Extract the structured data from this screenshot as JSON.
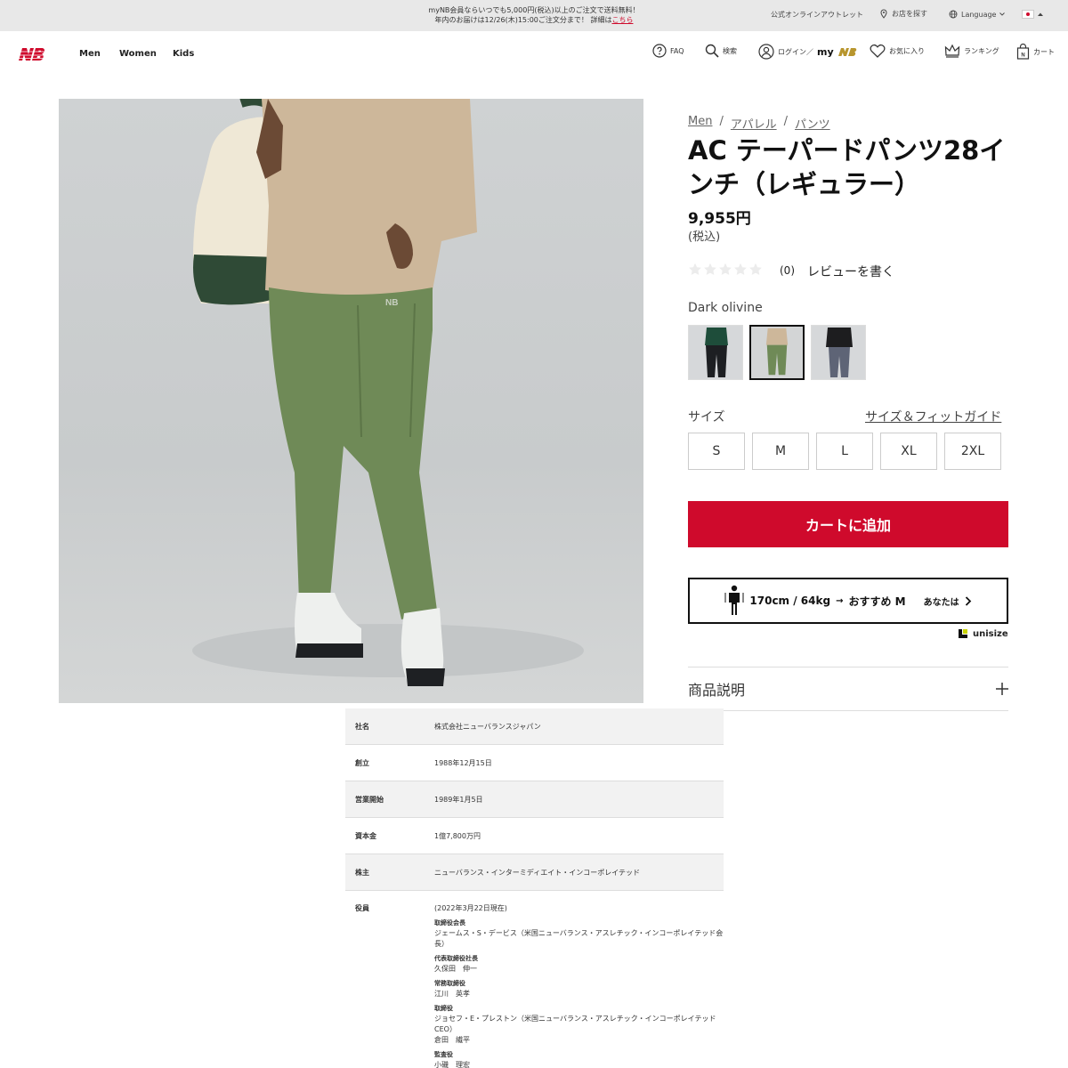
{
  "banner": {
    "line1": "myNB会員ならいつでも5,000円(税込)以上のご注文で送料無料！",
    "line2_prefix": "年内のお届けは12/26(木)15:00ご注文分まで！ 詳細は",
    "line2_link": "こちら"
  },
  "utility": {
    "outlet": "公式オンラインアウトレット",
    "store": "お店を探す",
    "language": "Language"
  },
  "nav": [
    "Men",
    "Women",
    "Kids"
  ],
  "header_icons": {
    "faq": "FAQ",
    "search": "検索",
    "login": "ログイン／",
    "mynb": "my",
    "favorites": "お気に入り",
    "ranking": "ランキング",
    "cart": "カート"
  },
  "breadcrumb": [
    "Men",
    "アパレル",
    "パンツ"
  ],
  "product": {
    "title": "AC テーパードパンツ28インチ（レギュラー）",
    "price": "9,955円",
    "tax": "(税込)",
    "rating_count": "(0)",
    "write_review": "レビューを書く",
    "color_name": "Dark olivine",
    "size_label": "サイズ",
    "size_guide": "サイズ＆フィットガイド",
    "sizes": [
      "S",
      "M",
      "L",
      "XL",
      "2XL"
    ],
    "add_to_cart": "カートに追加",
    "unisize_text": "170cm / 64kg",
    "unisize_reco": "おすすめ M",
    "unisize_you": "あなたは",
    "unisize_brand": "unisize",
    "description": "商品説明"
  },
  "swatches": [
    {
      "name": "black",
      "pants": "#1d1f22",
      "top": "#1e4d3a"
    },
    {
      "name": "dark-olivine",
      "pants": "#6f8a57",
      "top": "#cdb79a"
    },
    {
      "name": "grey",
      "pants": "#5e6476",
      "top": "#1d1d1f"
    }
  ],
  "company": {
    "rows": [
      {
        "k": "社名",
        "v": "株式会社ニューバランスジャパン"
      },
      {
        "k": "創立",
        "v": "1988年12月15日"
      },
      {
        "k": "営業開始",
        "v": "1989年1月5日"
      },
      {
        "k": "資本金",
        "v": "1億7,800万円"
      },
      {
        "k": "株主",
        "v": "ニューバランス・インターミディエイト・インコーポレイテッド"
      }
    ],
    "exec_label": "役員",
    "exec_date": "(2022年3月22日現在)",
    "execs": [
      {
        "role": "取締役会長",
        "name": "ジェームス・S・デービス（米国ニューバランス・アスレチック・インコーポレイテッド会長）"
      },
      {
        "role": "代表取締役社長",
        "name": "久保田　伸一"
      },
      {
        "role": "常務取締役",
        "name": "江川　英孝"
      },
      {
        "role": "取締役",
        "name": "ジョセフ・E・プレストン（米国ニューバランス・アスレチック・インコーポレイテッドCEO）"
      },
      {
        "role": "",
        "name": "倉田　繊平"
      },
      {
        "role": "監査役",
        "name": "小磯　理宏"
      }
    ]
  },
  "colors": {
    "brand": "#cf0a2c",
    "olive": "#6f8a57"
  }
}
